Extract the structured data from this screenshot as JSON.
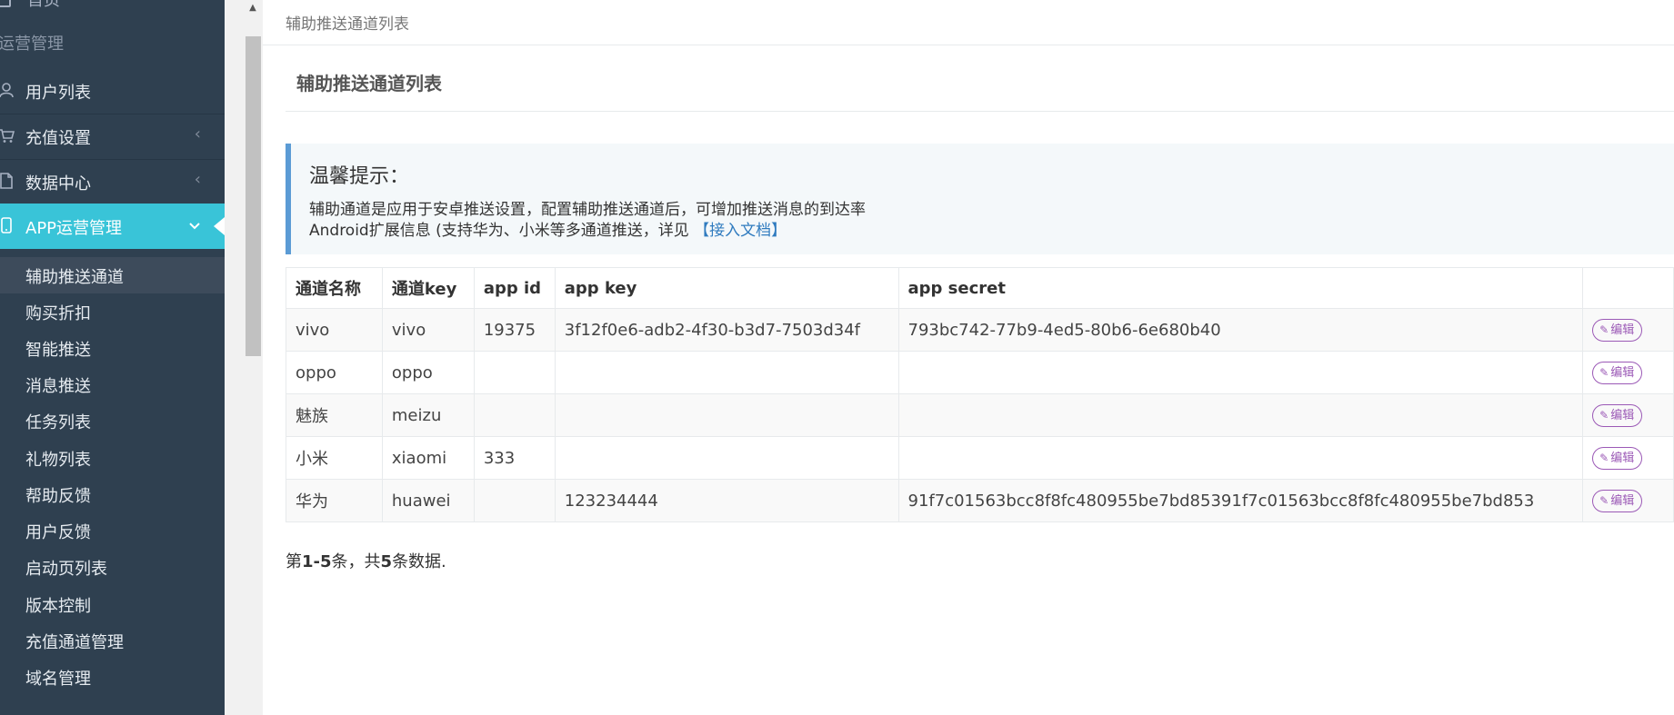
{
  "sidebar": {
    "partial_top_label": "首页",
    "section_label": "运营管理",
    "items": [
      {
        "label": "用户列表",
        "icon": "user-icon",
        "has_chevron": false
      },
      {
        "label": "充值设置",
        "icon": "cart-icon",
        "has_chevron": true,
        "chevron": "‹"
      },
      {
        "label": "数据中心",
        "icon": "file-icon",
        "has_chevron": true,
        "chevron": "‹"
      },
      {
        "label": "APP运营管理",
        "icon": "mobile-icon",
        "has_chevron": true,
        "chevron": "⌄",
        "active": true
      }
    ],
    "subitems": [
      {
        "label": "辅助推送通道",
        "active": true
      },
      {
        "label": "购买折扣"
      },
      {
        "label": "智能推送"
      },
      {
        "label": "消息推送"
      },
      {
        "label": "任务列表"
      },
      {
        "label": "礼物列表"
      },
      {
        "label": "帮助反馈"
      },
      {
        "label": "用户反馈"
      },
      {
        "label": "启动页列表"
      },
      {
        "label": "版本控制"
      },
      {
        "label": "充值通道管理"
      },
      {
        "label": "域名管理"
      }
    ],
    "colors": {
      "background": "#2f4050",
      "active": "#39c4d8"
    }
  },
  "breadcrumb": "辅助推送通道列表",
  "panel_title": "辅助推送通道列表",
  "notice": {
    "title": "温馨提示：",
    "line1": "辅助通道是应用于安卓推送设置，配置辅助推送通道后，可增加推送消息的到达率",
    "line2_prefix": "Android扩展信息 (支持华为、小米等多通道推送，详见",
    "link": "【接入文档】"
  },
  "table": {
    "columns": [
      "通道名称",
      "通道key",
      "app id",
      "app key",
      "app secret",
      ""
    ],
    "rows": [
      {
        "name": "vivo",
        "key": "vivo",
        "app_id": "19375",
        "app_key": "3f12f0e6-adb2-4f30-b3d7-7503d34f",
        "app_secret": "793bc742-77b9-4ed5-80b6-6e680b40",
        "action": "编辑"
      },
      {
        "name": "oppo",
        "key": "oppo",
        "app_id": "",
        "app_key": "",
        "app_secret": "",
        "action": "编辑"
      },
      {
        "name": "魅族",
        "key": "meizu",
        "app_id": "",
        "app_key": "",
        "app_secret": "",
        "action": "编辑"
      },
      {
        "name": "小米",
        "key": "xiaomi",
        "app_id": "333",
        "app_key": "",
        "app_secret": "",
        "action": "编辑"
      },
      {
        "name": "华为",
        "key": "huawei",
        "app_id": "",
        "app_key": "123234444",
        "app_secret": "91f7c01563bcc8f8fc480955be7bd85391f7c01563bcc8f8fc480955be7bd853",
        "action": "编辑"
      }
    ]
  },
  "summary": {
    "prefix": "第",
    "range": "1-5",
    "mid": "条，共",
    "total": "5",
    "suffix": "条数据."
  }
}
